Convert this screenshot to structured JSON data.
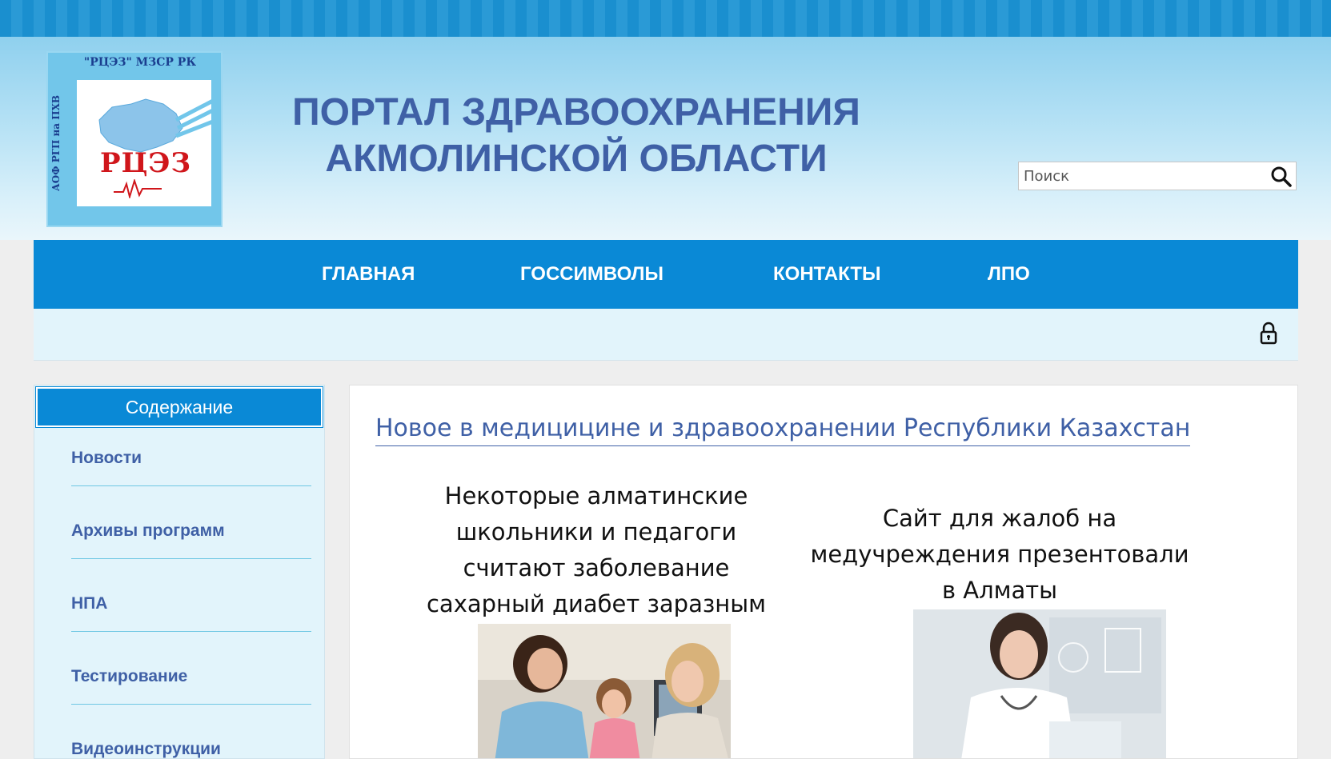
{
  "header": {
    "title_line1": "ПОРТАЛ ЗДРАВООХРАНЕНИЯ",
    "title_line2": "АКМОЛИНСКОЙ ОБЛАСТИ",
    "logo": {
      "top_text": "\"РЦЭЗ\" МЗСР РК",
      "side_text": "АОФ РГП на ПХВ",
      "mark": "РЦЭЗ"
    },
    "search_placeholder": "Поиск"
  },
  "nav": {
    "items": [
      {
        "label": "ГЛАВНАЯ"
      },
      {
        "label": "ГОССИМВОЛЫ"
      },
      {
        "label": "КОНТАКТЫ"
      },
      {
        "label": "ЛПО"
      }
    ]
  },
  "sidebar": {
    "title": "Содержание",
    "items": [
      {
        "label": "Новости"
      },
      {
        "label": "Архивы программ"
      },
      {
        "label": "НПА"
      },
      {
        "label": "Тестирование"
      },
      {
        "label": "Видеоинструкции"
      }
    ]
  },
  "main": {
    "section_title": "Новое в медицицине и здравоохранении Республики Казахстан",
    "news": [
      {
        "title": "Некоторые алматинские школьники и педагоги считают заболевание сахарный диабет заразным"
      },
      {
        "title": "Сайт для жалоб на медучреждения презентовали в Алматы"
      }
    ]
  },
  "colors": {
    "brand_blue": "#0a89d6",
    "title_blue": "#3f60a6",
    "light_bg": "#e2f4fb"
  },
  "icons": {
    "search": "search-icon",
    "lock": "lock-icon"
  }
}
